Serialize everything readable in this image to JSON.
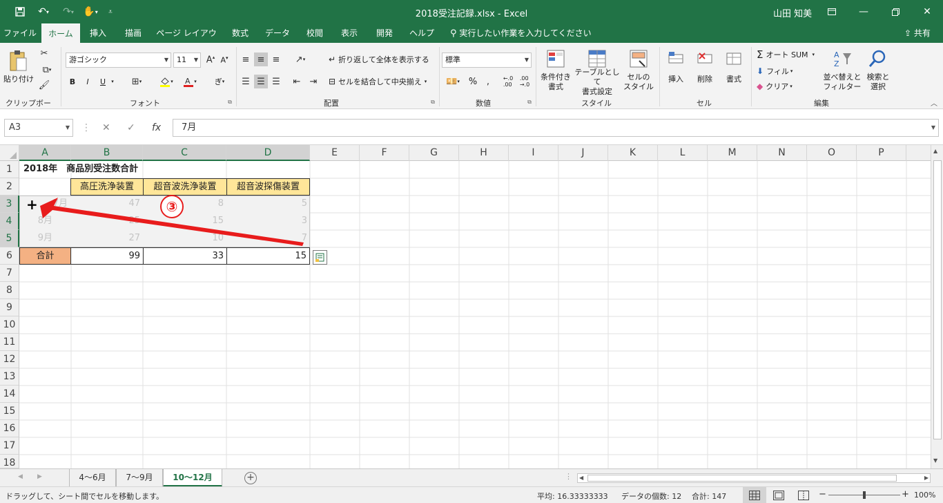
{
  "titlebar": {
    "title": "2018受注記録.xlsx  -  Excel",
    "user": "山田 知美",
    "bg_color": "#217346"
  },
  "tabs": [
    "ファイル",
    "ホーム",
    "挿入",
    "描画",
    "ページ レイアウト",
    "数式",
    "データ",
    "校閲",
    "表示",
    "開発",
    "ヘルプ"
  ],
  "active_tab": "ホーム",
  "tellme": "実行したい作業を入力してください",
  "share": "共有",
  "ribbon": {
    "clipboard": {
      "paste": "貼り付け",
      "label": "クリップボード"
    },
    "font": {
      "name": "游ゴシック",
      "size": "11",
      "bold": "B",
      "italic": "I",
      "underline": "U",
      "label": "フォント"
    },
    "alignment": {
      "wrap": "折り返して全体を表示する",
      "merge": "セルを結合して中央揃え",
      "label": "配置"
    },
    "number": {
      "format": "標準",
      "percent": "%",
      "label": "数値"
    },
    "styles": {
      "conditional": "条件付き\n書式",
      "table": "テーブルとして\n書式設定",
      "cell": "セルの\nスタイル",
      "label": "スタイル"
    },
    "cells": {
      "insert": "挿入",
      "delete": "削除",
      "format": "書式",
      "label": "セル"
    },
    "editing": {
      "autosum": "オート SUM",
      "fill": "フィル",
      "clear": "クリア",
      "sort": "並べ替えと\nフィルター",
      "find": "検索と\n選択",
      "label": "編集"
    }
  },
  "formula_bar": {
    "name_box": "A3",
    "cancel": "✕",
    "enter": "✓",
    "fx": "fx",
    "value": "7月"
  },
  "columns": [
    "A",
    "B",
    "C",
    "D",
    "E",
    "F",
    "G",
    "H",
    "I",
    "J",
    "K",
    "L",
    "M",
    "N",
    "O",
    "P"
  ],
  "rows": [
    "1",
    "2",
    "3",
    "4",
    "5",
    "6",
    "7",
    "8",
    "9",
    "10",
    "11",
    "12",
    "13",
    "14",
    "15",
    "16",
    "17",
    "18"
  ],
  "sheet": {
    "title": "2018年　商品別受注数合計",
    "headers": [
      "高圧洗浄装置",
      "超音波洗浄装置",
      "超音波探傷装置"
    ],
    "data_rows": [
      {
        "label": "7月",
        "values": [
          "47",
          "8",
          "5"
        ]
      },
      {
        "label": "8月",
        "values": [
          "25",
          "15",
          "3"
        ]
      },
      {
        "label": "9月",
        "values": [
          "27",
          "10",
          "7"
        ]
      }
    ],
    "total_label": "合計",
    "totals": [
      "99",
      "33",
      "15"
    ]
  },
  "annotation": {
    "marker": "③",
    "color": "#e81c1c"
  },
  "sheet_tabs": [
    "4～6月",
    "7～9月",
    "10～12月"
  ],
  "active_sheet": "10～12月",
  "status": {
    "message": "ドラッグして、シート間でセルを移動します。",
    "average": "平均: 16.33333333",
    "count": "データの個数: 12",
    "sum": "合計: 147",
    "zoom": "100%"
  }
}
